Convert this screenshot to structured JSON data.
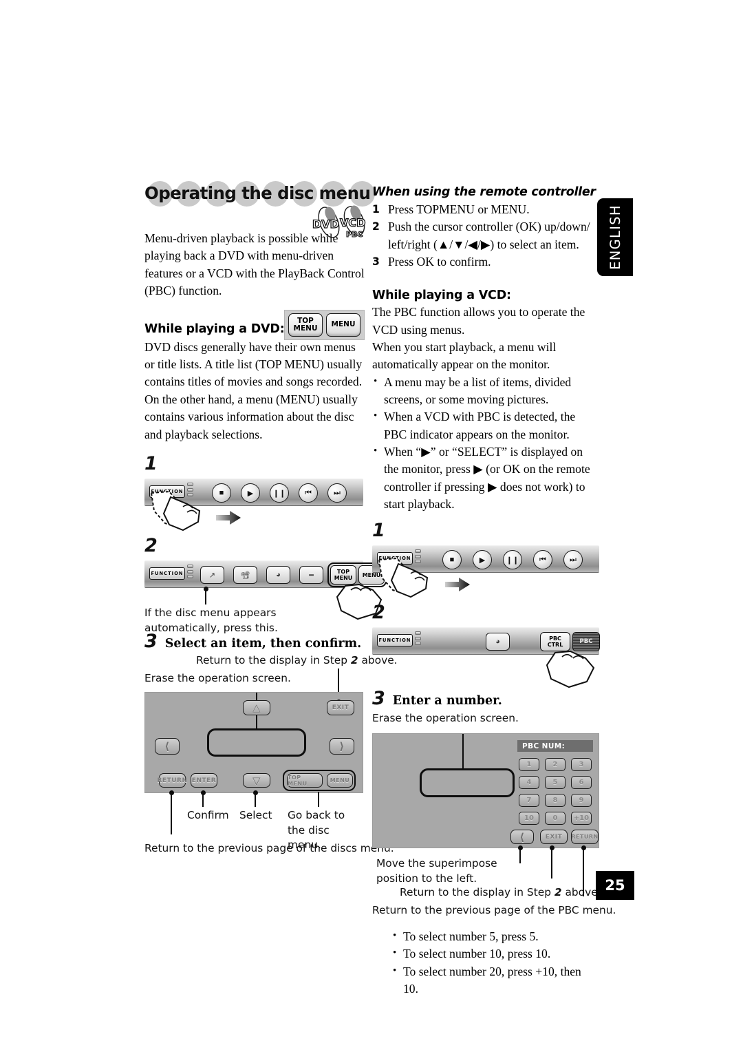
{
  "page": {
    "number": "25",
    "language_tab": "ENGLISH"
  },
  "heading": {
    "title": "Operating the disc menu",
    "disc_logo": [
      "DVD",
      "VCD",
      "PBC"
    ]
  },
  "left_column": {
    "intro": "Menu-driven playback is possible while playing back a DVD with menu-driven features or a VCD with the PlayBack Control (PBC) function.",
    "dvd_heading": "While playing a DVD:",
    "dvd_keys": [
      {
        "line1": "TOP",
        "line2": "MENU"
      },
      {
        "line1": "MENU",
        "line2": ""
      }
    ],
    "dvd_body": "DVD discs generally have their own menus or title lists. A title list (TOP MENU) usually contains titles of movies and songs recorded. On the other hand, a menu (MENU) usually contains various information about the disc and playback selections.",
    "step1": {
      "number": "1",
      "toolbar": {
        "function_label": "FUNCTION",
        "buttons": [
          "stop-icon",
          "play-icon",
          "pause-icon",
          "previous-track-icon",
          "next-track-icon"
        ]
      }
    },
    "step2": {
      "number": "2",
      "toolbar": {
        "function_label": "FUNCTION",
        "buttons": [
          "arrow-diagonal-icon",
          "screen-icon",
          "audio-icon",
          "subtitle-icon"
        ],
        "menu_keys": [
          {
            "line1": "TOP",
            "line2": "MENU"
          },
          {
            "line1": "MENU",
            "line2": ""
          }
        ]
      },
      "caption": "If the disc menu appears automatically, press this."
    },
    "step3": {
      "number": "3",
      "title": "Select an item, then confirm.",
      "callout_return_pre": "Return to the display in Step ",
      "callout_return_em": "2",
      "callout_return_post": " above.",
      "callout_erase": "Erase the operation screen.",
      "osd": {
        "up_label": "up-chevron-icon",
        "down_label": "down-chevron-icon",
        "left_label": "left-chevron-icon",
        "right_label": "right-chevron-icon",
        "exit": "EXIT",
        "return": "RETURN",
        "enter": "ENTER",
        "top_menu": "TOP MENU",
        "menu": "MENU"
      },
      "labels": {
        "confirm": "Confirm",
        "select": "Select",
        "goback": "Go back to the disc menu.",
        "previous_page": "Return to the previous page of the discs menu."
      }
    }
  },
  "right_column": {
    "remote_heading": "When using the remote controller",
    "remote_steps": [
      {
        "n": "1",
        "text": "Press TOPMENU or MENU."
      },
      {
        "n": "2",
        "text": "Push the cursor controller (OK) up/down/ left/right (▲/▼/◀/▶) to select an item."
      },
      {
        "n": "3",
        "text": "Press OK to confirm."
      }
    ],
    "vcd_heading": "While playing a VCD:",
    "vcd_body1": "The PBC function allows you to operate the VCD using menus.",
    "vcd_body2": "When you start playback, a menu will automatically appear on the monitor.",
    "vcd_bullets": [
      "A menu may be a list of items, divided screens, or some moving pictures.",
      "When a VCD with PBC is detected, the PBC indicator appears on the monitor.",
      "When “▶” or “SELECT” is displayed on the monitor, press ▶ (or OK on the remote controller if pressing ▶ does not work) to start playback."
    ],
    "step1": {
      "number": "1",
      "toolbar": {
        "function_label": "FUNCTION",
        "buttons": [
          "stop-icon",
          "play-icon",
          "pause-icon",
          "previous-track-icon",
          "next-track-icon"
        ]
      }
    },
    "step2": {
      "number": "2",
      "toolbar": {
        "function_label": "FUNCTION",
        "audio_button": "audio-icon",
        "pbc_ctrl": {
          "line1": "PBC",
          "line2": "CTRL"
        },
        "pbc_active": "PBC"
      }
    },
    "step3": {
      "number": "3",
      "title": "Enter a number.",
      "callout_erase": "Erase the operation screen.",
      "osd": {
        "pbc_num_title": "PBC NUM:",
        "keys": [
          "1",
          "2",
          "3",
          "4",
          "5",
          "6",
          "7",
          "8",
          "9",
          "10",
          "0",
          "+10"
        ],
        "left_chev": "left-chevron-icon",
        "exit": "EXIT",
        "return": "RETURN"
      },
      "labels": {
        "move_left": "Move the superimpose position to the left.",
        "return_step_pre": "Return to the display in Step ",
        "return_step_em": "2",
        "return_step_post": " above.",
        "previous_page": "Return to the previous page of the PBC menu."
      },
      "notes": [
        "To select number 5, press 5.",
        "To select number 10, press 10.",
        "To select number 20, press +10, then 10."
      ]
    }
  }
}
